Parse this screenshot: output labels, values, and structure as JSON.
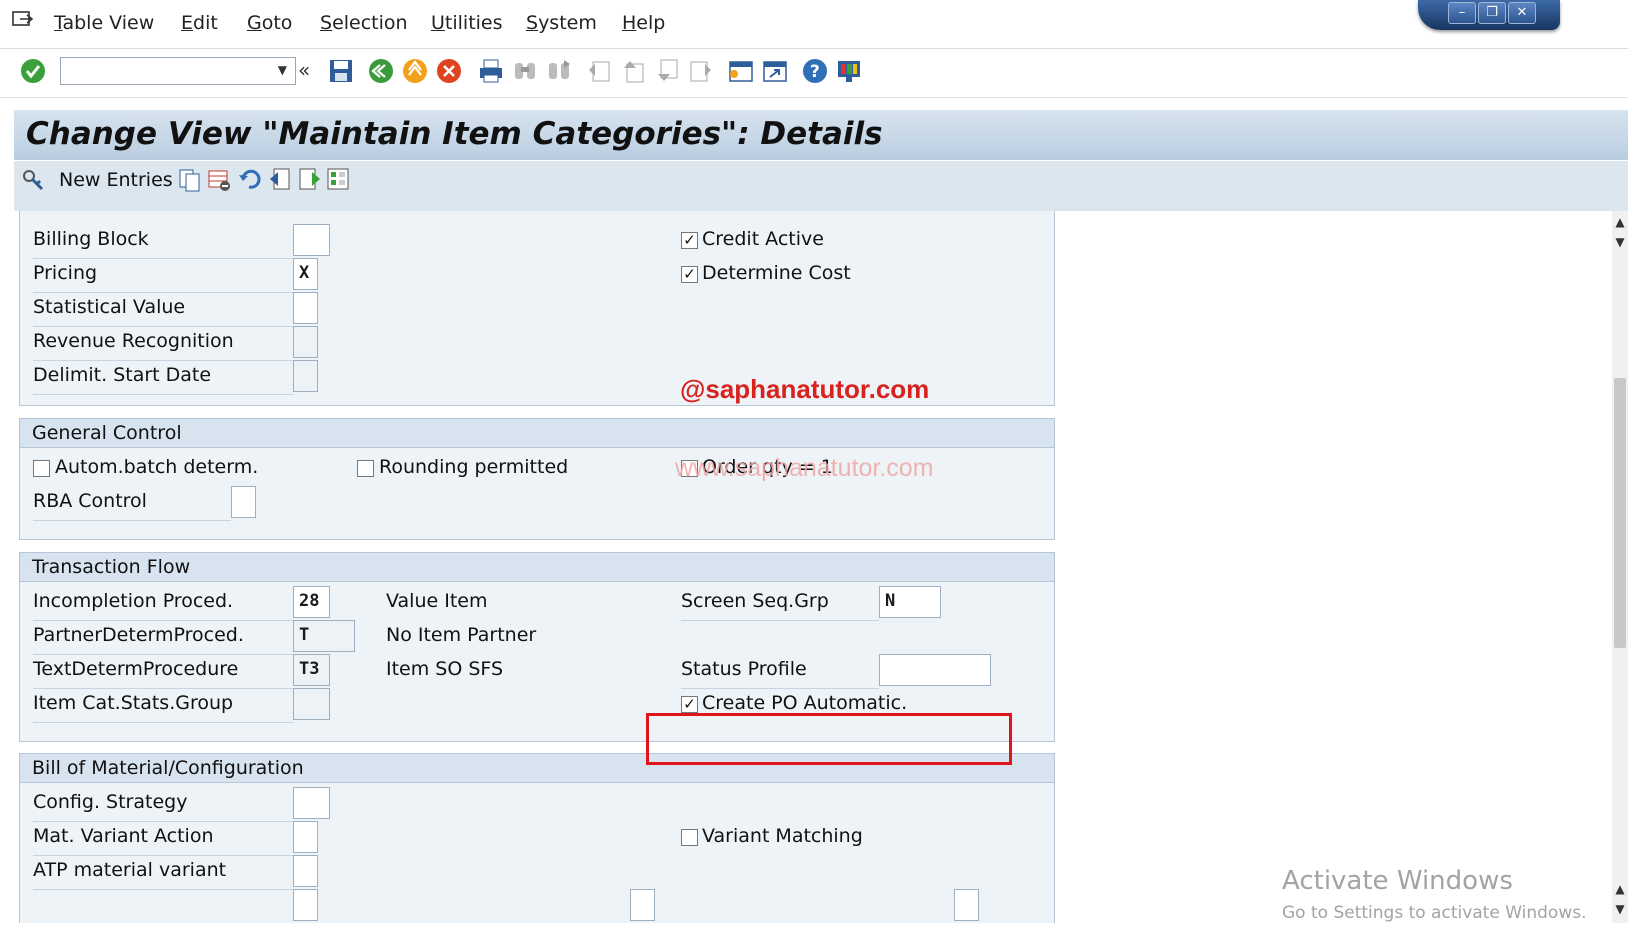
{
  "menu": {
    "items": [
      "Table View",
      "Edit",
      "Goto",
      "Selection",
      "Utilities",
      "System",
      "Help"
    ]
  },
  "toolbar": {
    "command_field_value": "",
    "icons": [
      "enter-icon",
      "back-icon",
      "save-icon",
      "exit-icon",
      "cancel-icon",
      "print-icon",
      "find-icon",
      "find-next-icon",
      "first-page-icon",
      "previous-page-icon",
      "next-page-icon",
      "last-page-icon",
      "new-session-icon",
      "shortcut-icon",
      "help-icon",
      "customize-layout-icon"
    ]
  },
  "title": "Change View \"Maintain Item Categories\": Details",
  "app_toolbar": {
    "new_entries_label": "New Entries"
  },
  "section_top": {
    "fields": [
      {
        "label": "Billing Block",
        "value": ""
      },
      {
        "label": "Pricing",
        "value": "X"
      },
      {
        "label": "Statistical Value",
        "value": ""
      },
      {
        "label": "Revenue Recognition",
        "value": ""
      },
      {
        "label": "Delimit. Start Date",
        "value": ""
      }
    ],
    "checkboxes": [
      {
        "label": "Credit Active",
        "checked": true
      },
      {
        "label": "Determine Cost",
        "checked": true
      }
    ]
  },
  "general_control": {
    "title": "General Control",
    "checkboxes": [
      {
        "label": "Autom.batch determ.",
        "checked": false
      },
      {
        "label": "Rounding permitted",
        "checked": false
      },
      {
        "label": "Order qty = 1",
        "checked": false
      }
    ],
    "rba_label": "RBA Control",
    "rba_value": ""
  },
  "transaction_flow": {
    "title": "Transaction Flow",
    "fields": [
      {
        "label": "Incompletion Proced.",
        "value": "28"
      },
      {
        "label": "PartnerDetermProced.",
        "value": "T"
      },
      {
        "label": "TextDetermProcedure",
        "value": "T3"
      },
      {
        "label": "Item Cat.Stats.Group",
        "value": ""
      }
    ],
    "middle_labels": [
      "Value Item",
      "No Item Partner",
      "Item SO SFS"
    ],
    "screen_seq_label": "Screen Seq.Grp",
    "screen_seq_value": "N",
    "status_profile_label": "Status Profile",
    "status_profile_value": "",
    "create_po_label": "Create PO Automatic.",
    "create_po_checked": true
  },
  "bom_config": {
    "title": "Bill of Material/Configuration",
    "fields": [
      {
        "label": "Config. Strategy",
        "value": ""
      },
      {
        "label": "Mat. Variant Action",
        "value": ""
      },
      {
        "label": "ATP material variant",
        "value": ""
      }
    ],
    "variant_matching_label": "Variant Matching",
    "variant_matching_checked": false
  },
  "watermarks": {
    "handle": "@saphanatutor.com",
    "site": "www.saphanatutor.com"
  },
  "windows_notice": {
    "title": "Activate Windows",
    "subtitle": "Go to Settings to activate Windows."
  },
  "colors": {
    "title_bg": "#c6d6e6",
    "group_bg": "#eef3f8",
    "highlight_box": "#e0151b",
    "watermark": "#d7221e"
  }
}
